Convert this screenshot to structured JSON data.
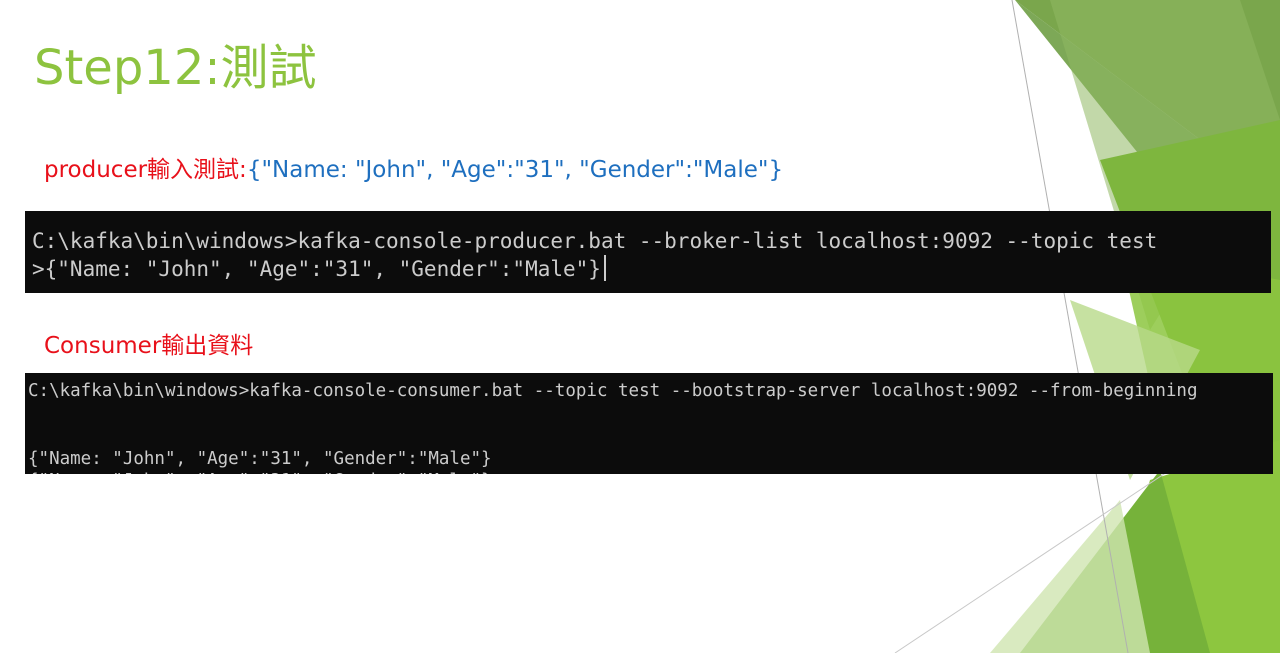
{
  "slide": {
    "title": "Step12:測試"
  },
  "producer_caption": {
    "label": "producer輸入測試:",
    "json": "{\"Name: \"John\", \"Age\":\"31\", \"Gender\":\"Male\"}"
  },
  "producer_terminal": {
    "command_line": "C:\\kafka\\bin\\windows>kafka-console-producer.bat --broker-list localhost:9092 --topic test",
    "input_line": ">{\"Name: \"John\", \"Age\":\"31\", \"Gender\":\"Male\"}"
  },
  "consumer_caption": {
    "label": "Consumer輸出資料"
  },
  "consumer_terminal": {
    "command_line": "C:\\kafka\\bin\\windows>kafka-console-consumer.bat --topic test --bootstrap-server localhost:9092 --from-beginning",
    "output_line": "{\"Name: \"John\", \"Age\":\"31\", \"Gender\":\"Male\"}"
  },
  "colors": {
    "title_green": "#8DC33F",
    "caption_red": "#E8101A",
    "caption_blue": "#1E6FBF",
    "terminal_bg": "#0C0C0C",
    "terminal_text": "#CCCCCC"
  }
}
